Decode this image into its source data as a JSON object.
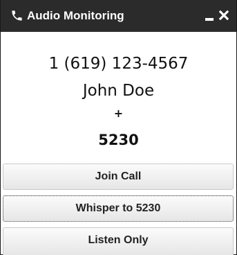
{
  "window": {
    "title": "Audio Monitoring",
    "title_icon": "phone-icon",
    "controls": [
      "minimize-icon",
      "close-icon"
    ]
  },
  "call": {
    "phone_number": "1 (619) 123-4567",
    "caller_name": "John Doe",
    "separator": "+",
    "extension": "5230"
  },
  "actions": {
    "join_label": "Join Call",
    "whisper_label": "Whisper to 5230",
    "listen_label": "Listen Only"
  },
  "colors": {
    "titlebar_bg": "#2b2b2b",
    "titlebar_text": "#ffffff",
    "body_bg": "#ffffff"
  }
}
